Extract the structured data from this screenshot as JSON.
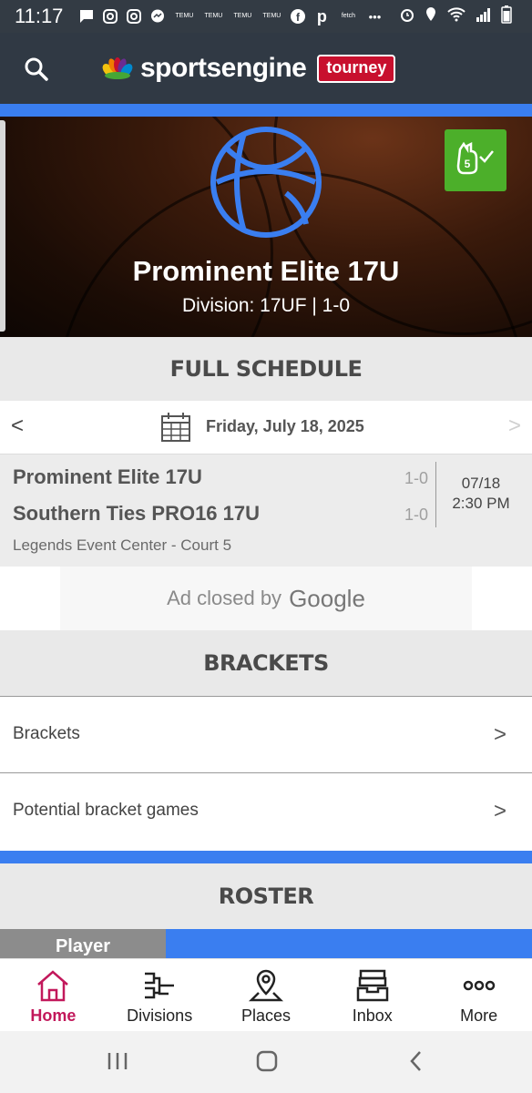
{
  "status_bar": {
    "time": "11:17",
    "temu_label": "TEMU",
    "fetch_label": "fetch"
  },
  "header": {
    "logo_text": "sportsengine",
    "logo_badge": "tourney"
  },
  "hero": {
    "team_name": "Prominent Elite 17U",
    "division_line": "Division: 17UF | 1-0",
    "fan_badge_number": "5"
  },
  "schedule": {
    "title": "FULL SCHEDULE",
    "prev": "<",
    "next": ">",
    "date": "Friday, July 18, 2025",
    "game": {
      "team1": "Prominent Elite 17U",
      "team1_record": "1-0",
      "team2": "Southern Ties PRO16 17U",
      "team2_record": "1-0",
      "date": "07/18",
      "time": "2:30 PM",
      "venue": "Legends Event Center - Court 5"
    }
  },
  "ad": {
    "text": "Ad closed by",
    "brand": "Google"
  },
  "brackets": {
    "title": "BRACKETS",
    "items": [
      {
        "label": "Brackets",
        "chevron": ">"
      },
      {
        "label": "Potential bracket games",
        "chevron": ">"
      }
    ]
  },
  "roster": {
    "title": "ROSTER",
    "column_player": "Player"
  },
  "bottom_nav": {
    "items": [
      {
        "label": "Home",
        "icon": "home-icon",
        "active": true
      },
      {
        "label": "Divisions",
        "icon": "bracket-icon"
      },
      {
        "label": "Places",
        "icon": "map-pin-icon"
      },
      {
        "label": "Inbox",
        "icon": "inbox-icon"
      },
      {
        "label": "More",
        "icon": "more-dots-icon"
      }
    ]
  },
  "colors": {
    "accent_blue": "#3a7ef0",
    "header_dark": "#303944",
    "brand_red": "#c8102e",
    "active_nav": "#c2185b",
    "fan_green": "#4caf2a"
  }
}
